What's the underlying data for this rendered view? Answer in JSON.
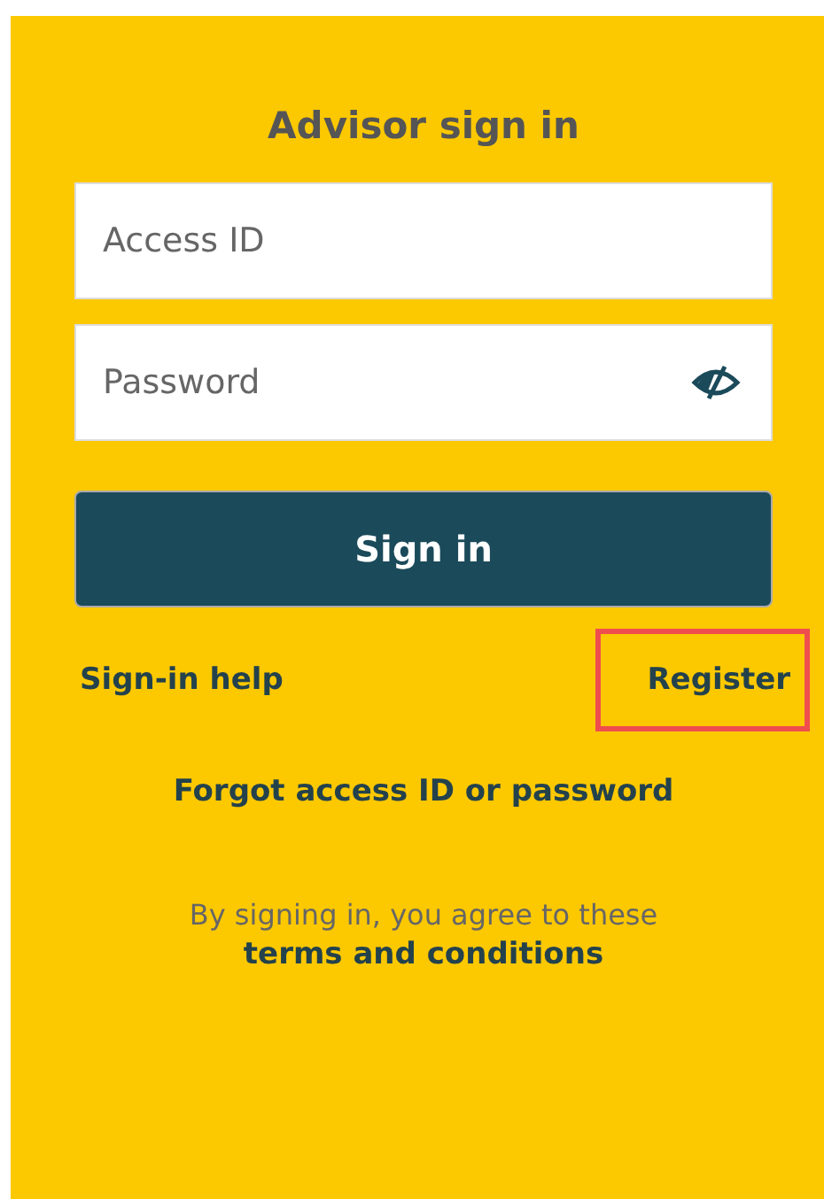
{
  "title": "Advisor sign in",
  "fields": [
    {
      "placeholder": "Access ID",
      "kind": "text"
    },
    {
      "placeholder": "Password",
      "kind": "password"
    }
  ],
  "submit": "Sign in",
  "links": [
    {
      "label": "Sign-in help",
      "highlighted": false
    },
    {
      "label": "Register",
      "highlighted": true
    }
  ],
  "forgot": "Forgot access ID or password",
  "agreement": {
    "text": "By signing in, you agree to these",
    "link": "terms and conditions"
  }
}
